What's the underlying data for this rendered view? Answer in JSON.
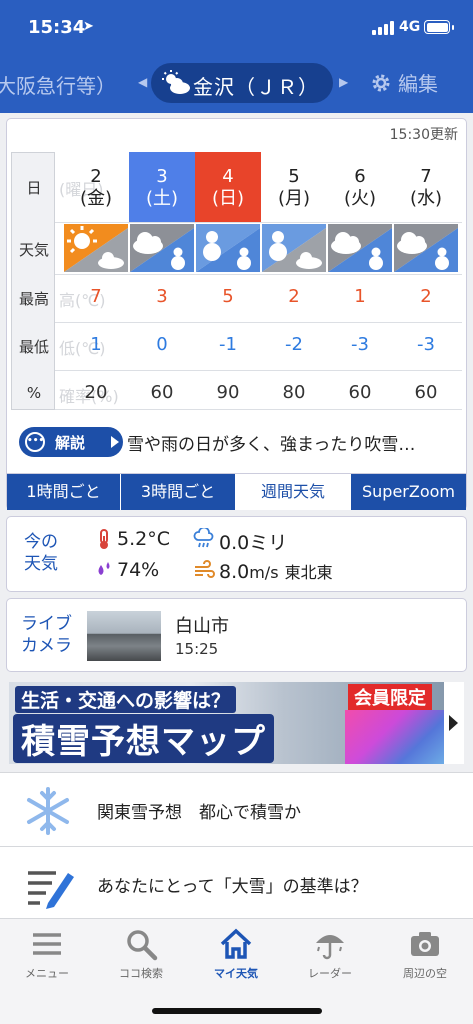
{
  "status_bar": {
    "time": "15:34",
    "network": "4G"
  },
  "header": {
    "prev_location": "大阪急行等）",
    "location": "金沢（ＪＲ）",
    "edit_label": "編集"
  },
  "forecast": {
    "updated": "15:30更新",
    "row_labels": {
      "day": "日",
      "weather": "天気",
      "high": "最高",
      "low": "最低",
      "precip": "%"
    },
    "ghost_labels": {
      "day": "(曜日)",
      "high": "高(℃)",
      "low": "低(℃)",
      "precip": "確率(%)"
    },
    "days": [
      {
        "date": "2",
        "dow": "(金)",
        "type": "weekday",
        "weather_icon": "sun-then-cloud-icon",
        "high": "7",
        "low": "1",
        "precip": "20"
      },
      {
        "date": "3",
        "dow": "(土)",
        "type": "sat",
        "weather_icon": "cloud-then-snow-icon",
        "high": "3",
        "low": "0",
        "precip": "60"
      },
      {
        "date": "4",
        "dow": "(日)",
        "type": "sun",
        "weather_icon": "snow-then-snow-icon",
        "high": "5",
        "low": "-1",
        "precip": "90"
      },
      {
        "date": "5",
        "dow": "(月)",
        "type": "weekday",
        "weather_icon": "snow-then-cloud-icon",
        "high": "2",
        "low": "-2",
        "precip": "80"
      },
      {
        "date": "6",
        "dow": "(火)",
        "type": "weekday",
        "weather_icon": "cloud-then-snow-icon",
        "high": "1",
        "low": "-3",
        "precip": "60"
      },
      {
        "date": "7",
        "dow": "(水)",
        "type": "weekday",
        "weather_icon": "cloud-then-snow-icon",
        "high": "2",
        "low": "-3",
        "precip": "60"
      }
    ],
    "explain_label": "解説",
    "explain_text": "雪や雨の日が多く、強まったり吹雪…",
    "tabs": [
      "1時間ごと",
      "3時間ごと",
      "週間天気",
      "SuperZoom"
    ],
    "active_tab": "週間天気"
  },
  "current": {
    "title": "今の天気",
    "temperature": "5.2°C",
    "precipitation": "0.0ミリ",
    "humidity": "74%",
    "wind_speed": "8.0",
    "wind_unit": "m/s",
    "wind_dir": "東北東"
  },
  "camera": {
    "title": "ライブカメラ",
    "place": "白山市",
    "time": "15:25"
  },
  "banner": {
    "line1": "生活・交通への影響は？",
    "line2": "積雪予想マップ",
    "badge": "会員限定"
  },
  "news": [
    {
      "text": "関東雪予想　都心で積雪か",
      "icon": "snowflake-icon"
    },
    {
      "text": "あなたにとって「大雪」の基準は？",
      "icon": "pencil-list-icon"
    }
  ],
  "bottom_nav": [
    {
      "label": "メニュー",
      "icon": "menu-icon"
    },
    {
      "label": "ココ検索",
      "icon": "search-icon"
    },
    {
      "label": "マイ天気",
      "icon": "home-icon"
    },
    {
      "label": "レーダー",
      "icon": "radar-umbrella-icon"
    },
    {
      "label": "周辺の空",
      "icon": "camera-icon"
    }
  ],
  "colors": {
    "brand": "#2a5ec0",
    "saturday": "#4f7fe8",
    "sunday": "#e8442a",
    "high_temp": "#e8542a",
    "low_temp": "#2e7be0"
  }
}
